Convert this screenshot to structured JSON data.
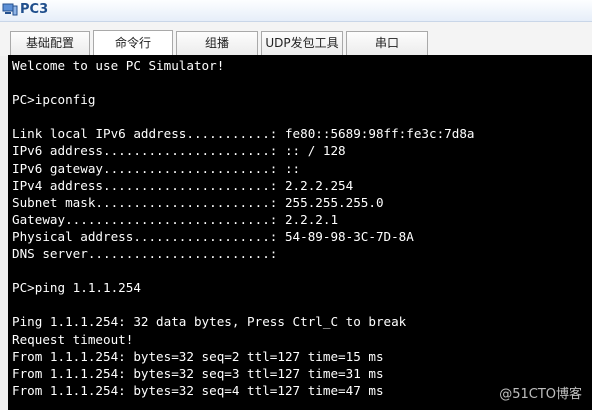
{
  "window": {
    "title": "PC3",
    "icon": "pc-icon"
  },
  "tabs": [
    {
      "label": "基础配置",
      "active": false
    },
    {
      "label": "命令行",
      "active": true
    },
    {
      "label": "组播",
      "active": false
    },
    {
      "label": "UDP发包工具",
      "active": false
    },
    {
      "label": "串口",
      "active": false
    }
  ],
  "console": {
    "lines": [
      "Welcome to use PC Simulator!",
      "",
      "PC>ipconfig",
      "",
      "Link local IPv6 address...........: fe80::5689:98ff:fe3c:7d8a",
      "IPv6 address......................: :: / 128",
      "IPv6 gateway......................: ::",
      "IPv4 address......................: 2.2.2.254",
      "Subnet mask.......................: 255.255.255.0",
      "Gateway...........................: 2.2.2.1",
      "Physical address..................: 54-89-98-3C-7D-8A",
      "DNS server........................:",
      "",
      "PC>ping 1.1.1.254",
      "",
      "Ping 1.1.1.254: 32 data bytes, Press Ctrl_C to break",
      "Request timeout!",
      "From 1.1.1.254: bytes=32 seq=2 ttl=127 time=15 ms",
      "From 1.1.1.254: bytes=32 seq=3 ttl=127 time=31 ms",
      "From 1.1.1.254: bytes=32 seq=4 ttl=127 time=47 ms"
    ]
  },
  "watermark": "@51CTO博客",
  "colors": {
    "console_bg": "#000000",
    "console_fg": "#ffffff",
    "title_color": "#1f4e8c"
  }
}
